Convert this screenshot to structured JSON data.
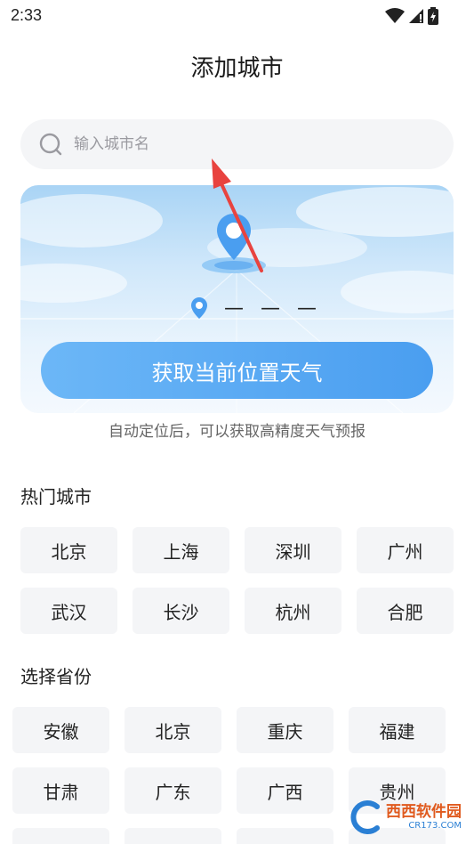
{
  "status_bar": {
    "time": "2:33"
  },
  "header": {
    "title": "添加城市"
  },
  "search": {
    "placeholder": "输入城市名"
  },
  "location": {
    "current_city": "— — —",
    "button_label": "获取当前位置天气",
    "hint": "自动定位后，可以获取高精度天气预报"
  },
  "hot_cities": {
    "title": "热门城市",
    "items": [
      "北京",
      "上海",
      "深圳",
      "广州",
      "武汉",
      "长沙",
      "杭州",
      "合肥"
    ]
  },
  "provinces": {
    "title": "选择省份",
    "items": [
      "安徽",
      "北京",
      "重庆",
      "福建",
      "甘肃",
      "广东",
      "广西",
      "贵州"
    ]
  },
  "watermark": {
    "text": "西西软件园",
    "sub": "CR173.COM"
  },
  "colors": {
    "accent": "#4a9ef0",
    "chip_bg": "#f4f5f7",
    "arrow": "#e8433f"
  }
}
